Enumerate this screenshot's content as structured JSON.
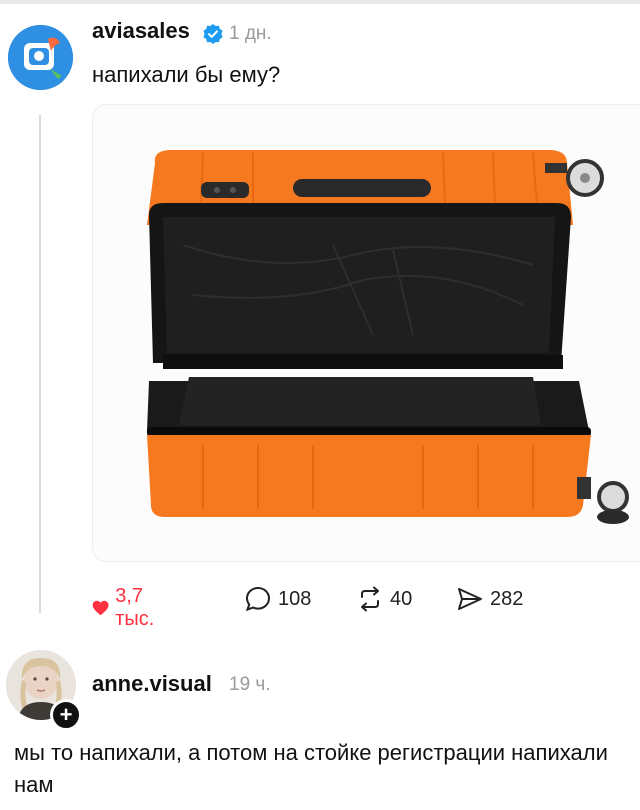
{
  "post": {
    "username": "aviasales",
    "time": "1 дн.",
    "text": "напихали бы ему?",
    "image_subject": "orange open hard-shell suitcase"
  },
  "actions": {
    "likes": "3,7 тыс.",
    "comments": "108",
    "reposts": "40",
    "shares": "282"
  },
  "reply": {
    "username": "anne.visual",
    "time": "19 ч.",
    "text": "мы то напихали, а потом на стойке регистрации напихали нам"
  },
  "colors": {
    "like": "#ff3040",
    "brand_avatar": "#2f8fe3",
    "verified": "#1d9bf0",
    "suitcase": "#f7791f"
  },
  "icons": [
    "heart-icon",
    "comment-icon",
    "repost-icon",
    "share-icon",
    "verified-icon",
    "plus-icon"
  ]
}
